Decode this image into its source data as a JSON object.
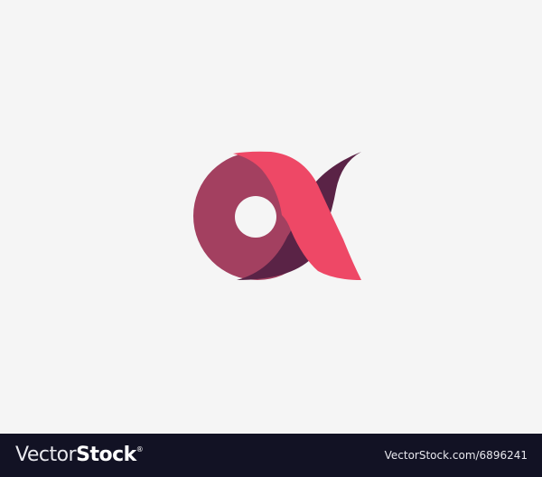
{
  "logo": {
    "description_icon": "alpha-letter-logo-icon",
    "colors": {
      "ring": "#a34060",
      "ribbon": "#ee4866",
      "shadow": "#5a2346",
      "background": "#f5f5f5"
    }
  },
  "footer": {
    "brand_light": "Vector",
    "brand_bold": "Stock",
    "brand_mark": "®",
    "image_id": "VectorStock.com/6896241",
    "background": "#121224"
  }
}
